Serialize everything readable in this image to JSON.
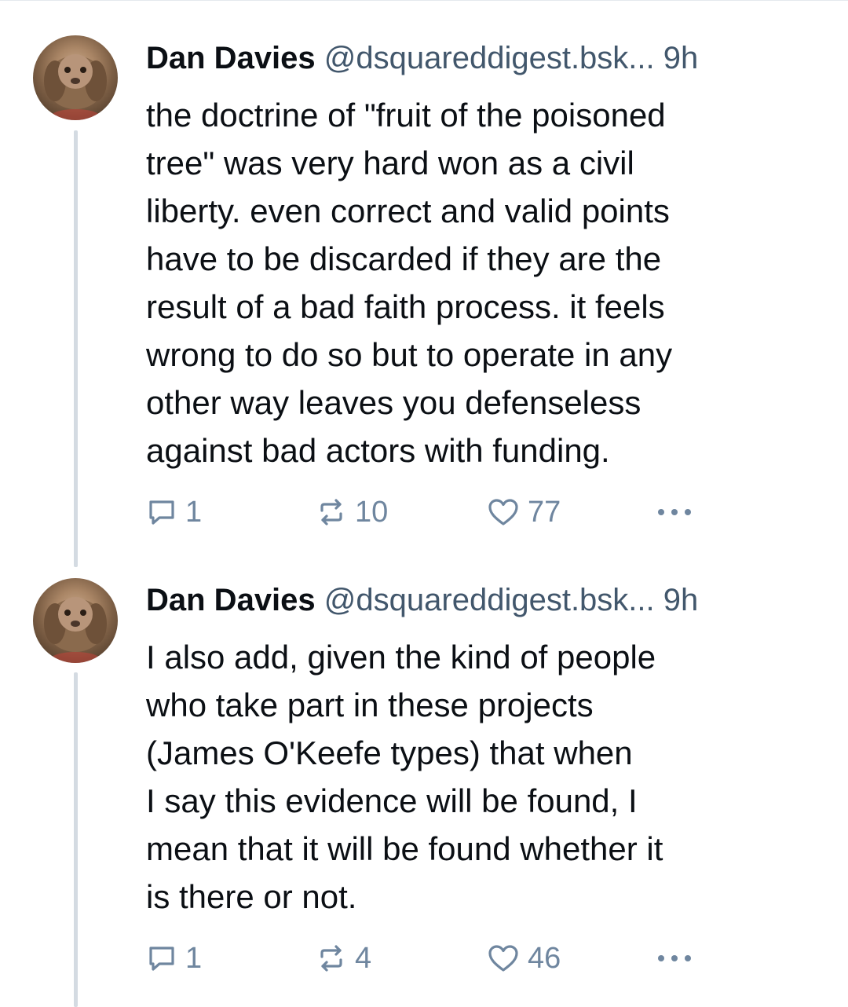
{
  "posts": [
    {
      "author_name": "Dan Davies",
      "handle": "@dsquareddigest.bsk...",
      "time": "9h",
      "text": "the doctrine of \"fruit of the poisoned\ntree\" was very hard won as a civil\nliberty. even correct and valid points\nhave to be discarded if they are the\nresult of a bad faith process. it feels\nwrong to do so but to operate in any\nother way leaves you defenseless\nagainst bad actors with funding.",
      "replies": "1",
      "reposts": "10",
      "likes": "77"
    },
    {
      "author_name": "Dan Davies",
      "handle": "@dsquareddigest.bsk...",
      "time": "9h",
      "text": "I also add, given the kind of people\nwho take part in these projects\n(James O'Keefe types) that when\nI say this evidence will be found, I\nmean that it will be found whether it\nis there or not.",
      "replies": "1",
      "reposts": "4",
      "likes": "46"
    }
  ],
  "icons": {
    "reply": "reply-icon",
    "repost": "repost-icon",
    "like": "heart-icon",
    "more": "more-options-icon"
  },
  "colors": {
    "text": "#0b0f14",
    "secondary": "#42576c",
    "icon": "#6f869f",
    "thread_line": "#d4dbe2"
  }
}
